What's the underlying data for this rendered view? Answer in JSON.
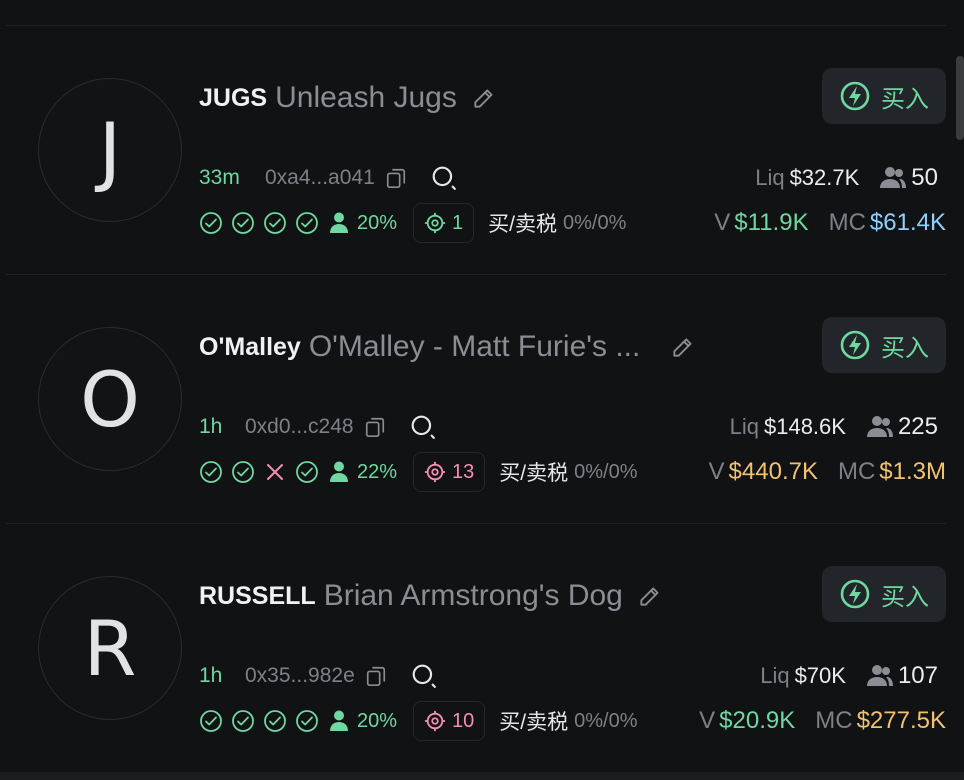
{
  "colors": {
    "green": "#6fd7a0",
    "blue": "#8fd0ff",
    "yellow": "#f3c26e",
    "pink": "#f48fb1",
    "red": "#f48fb1",
    "gray": "#7d8187"
  },
  "tokens": [
    {
      "avatar": "J",
      "symbol": "JUGS",
      "name": "Unleash Jugs",
      "age": "33m",
      "address": "0xa4...a041",
      "liq_label": "Liq",
      "liq": "$32.7K",
      "holders": "50",
      "checks": [
        "ok",
        "ok",
        "ok",
        "ok"
      ],
      "top_pct": "20%",
      "snipers": "1",
      "sniper_color": "#6fd7a0",
      "tax_label": "买/卖税",
      "tax": "0%/0%",
      "v_label": "V",
      "volume": "$11.9K",
      "volume_color": "#6fd7a0",
      "mc_label": "MC",
      "mc": "$61.4K",
      "mc_color": "#8fd0ff",
      "buy_label": "买入"
    },
    {
      "avatar": "O",
      "symbol": "O'Malley",
      "name": "O'Malley - Matt Furie's ...",
      "age": "1h",
      "address": "0xd0...c248",
      "liq_label": "Liq",
      "liq": "$148.6K",
      "holders": "225",
      "checks": [
        "ok",
        "ok",
        "fail",
        "ok"
      ],
      "top_pct": "22%",
      "snipers": "13",
      "sniper_color": "#f48fb1",
      "tax_label": "买/卖税",
      "tax": "0%/0%",
      "v_label": "V",
      "volume": "$440.7K",
      "volume_color": "#f3c26e",
      "mc_label": "MC",
      "mc": "$1.3M",
      "mc_color": "#f3c26e",
      "buy_label": "买入"
    },
    {
      "avatar": "R",
      "symbol": "RUSSELL",
      "name": "Brian Armstrong's Dog",
      "age": "1h",
      "address": "0x35...982e",
      "liq_label": "Liq",
      "liq": "$70K",
      "holders": "107",
      "checks": [
        "ok",
        "ok",
        "ok",
        "ok"
      ],
      "top_pct": "20%",
      "snipers": "10",
      "sniper_color": "#f48fb1",
      "tax_label": "买/卖税",
      "tax": "0%/0%",
      "v_label": "V",
      "volume": "$20.9K",
      "volume_color": "#6fd7a0",
      "mc_label": "MC",
      "mc": "$277.5K",
      "mc_color": "#f3c26e",
      "buy_label": "买入"
    }
  ]
}
